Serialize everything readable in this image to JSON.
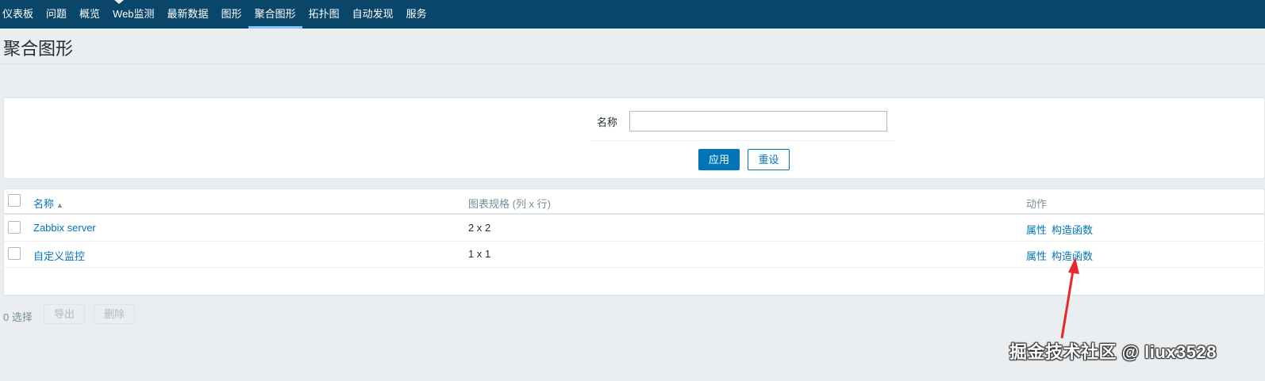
{
  "nav": {
    "items": [
      {
        "label": "仪表板"
      },
      {
        "label": "问题"
      },
      {
        "label": "概览"
      },
      {
        "label": "Web监测"
      },
      {
        "label": "最新数据"
      },
      {
        "label": "图形"
      },
      {
        "label": "聚合图形",
        "active": true
      },
      {
        "label": "拓扑图"
      },
      {
        "label": "自动发现"
      },
      {
        "label": "服务"
      }
    ]
  },
  "page": {
    "title": "聚合图形"
  },
  "filter": {
    "name_label": "名称",
    "name_value": "",
    "apply_label": "应用",
    "reset_label": "重设"
  },
  "table": {
    "columns": {
      "name": "名称",
      "dimensions": "图表规格 (列 x 行)",
      "actions": "动作"
    },
    "rows": [
      {
        "name": "Zabbix server",
        "dimensions": "2 x 2",
        "action_properties": "属性",
        "action_constructor": "构造函数"
      },
      {
        "name": "自定义监控",
        "dimensions": "1 x 1",
        "action_properties": "属性",
        "action_constructor": "构造函数"
      }
    ]
  },
  "footer": {
    "selected_count": "0 选择",
    "export_label": "导出",
    "delete_label": "删除"
  },
  "watermark": {
    "text": "掘金技术社区 @ liux3528"
  },
  "colors": {
    "header_bg": "#0a466a",
    "accent": "#0275b8",
    "annotation_arrow": "#e8262b"
  }
}
